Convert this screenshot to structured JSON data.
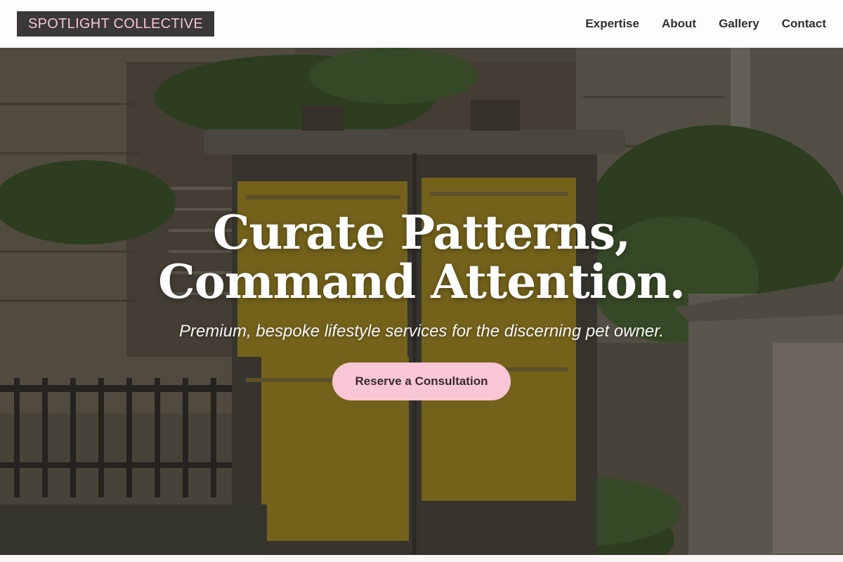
{
  "header": {
    "brand": "SPOTLIGHT COLLECTIVE",
    "nav": [
      {
        "label": "Expertise"
      },
      {
        "label": "About"
      },
      {
        "label": "Gallery"
      },
      {
        "label": "Contact"
      }
    ]
  },
  "hero": {
    "title_line1": "Curate Patterns,",
    "title_line2": "Command Attention.",
    "subtitle": "Premium, bespoke lifestyle services for the discerning pet owner.",
    "cta_label": "Reserve a Consultation"
  },
  "colors": {
    "brand_bg": "#3a3838",
    "brand_text": "#f7c4d4",
    "cta_bg": "#f8c6d4",
    "nav_text": "#2f2f2f"
  }
}
